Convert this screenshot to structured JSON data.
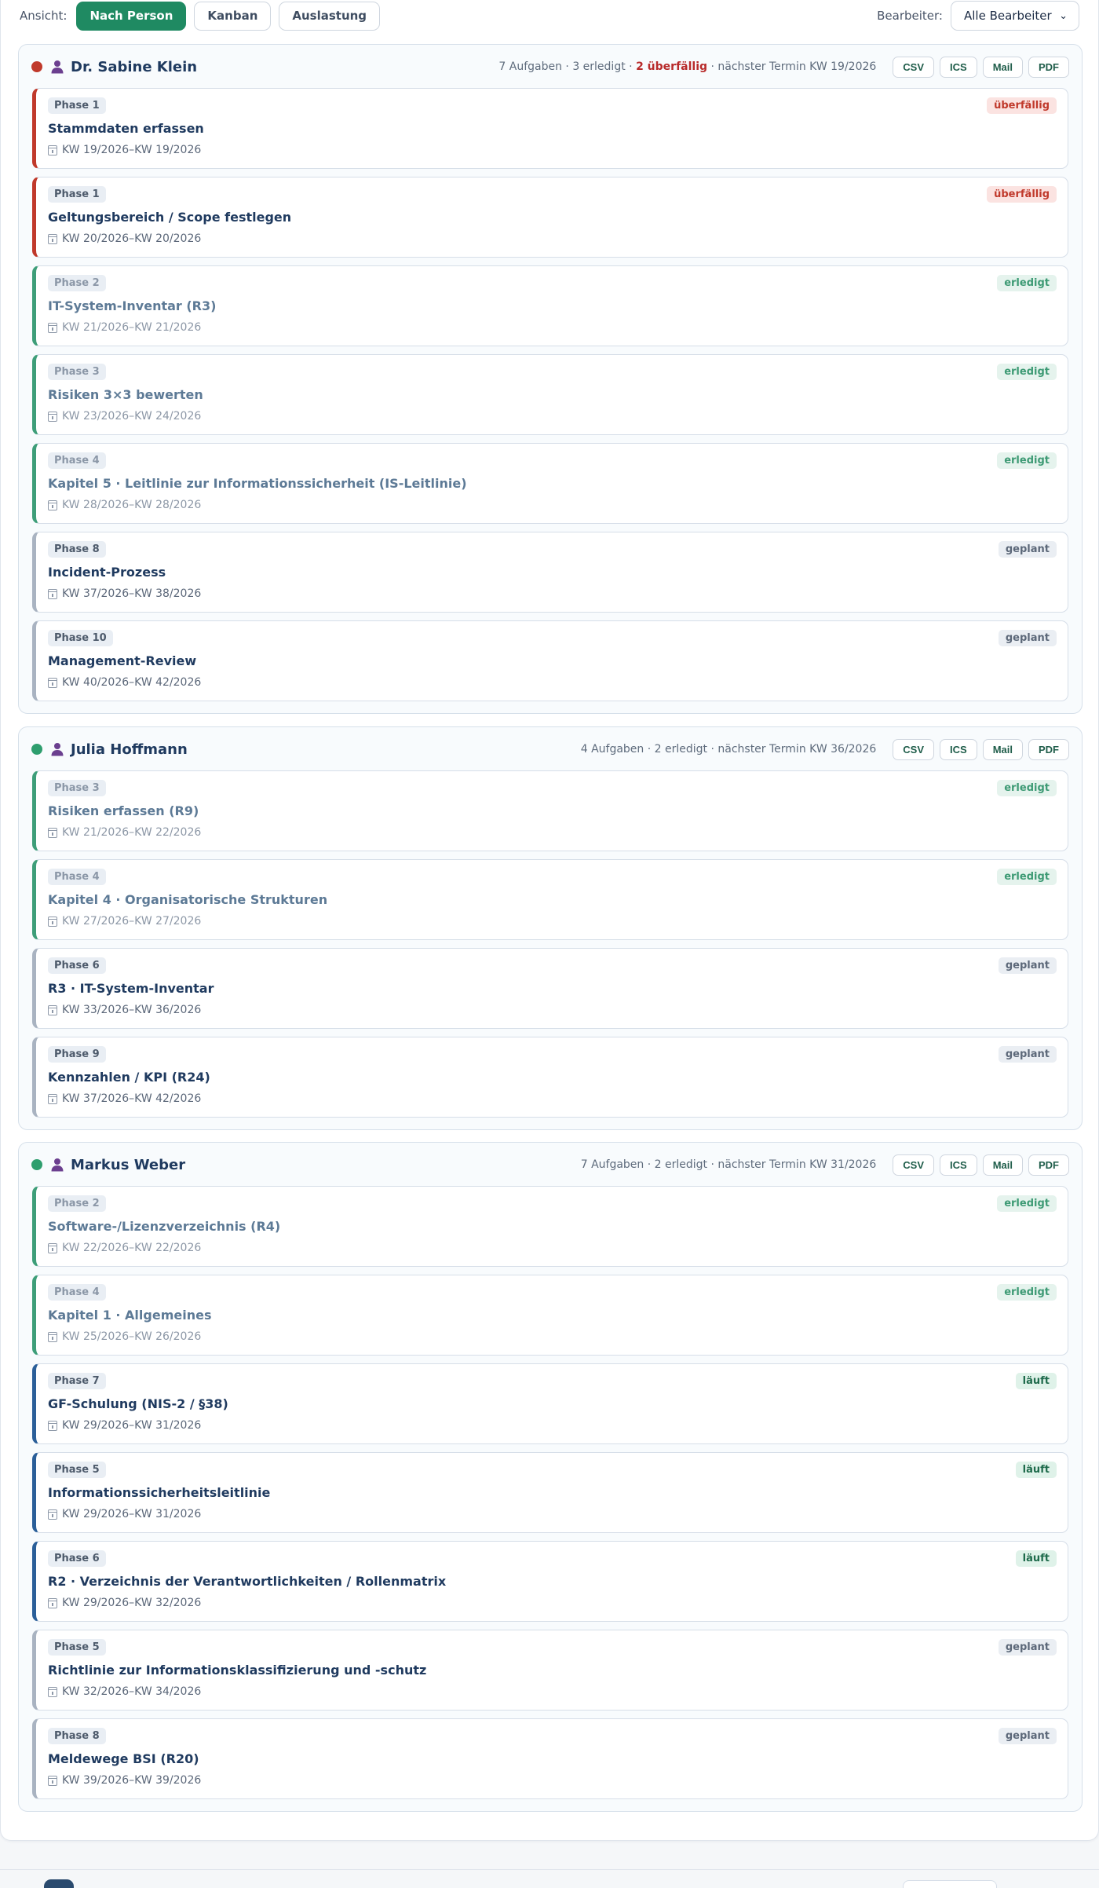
{
  "toolbar": {
    "ansicht_label": "Ansicht:",
    "views": [
      "Nach Person",
      "Kanban",
      "Auslastung"
    ],
    "active_view": "Nach Person",
    "bearbeiter_label": "Bearbeiter:",
    "bearbeiter_value": "Alle Bearbeiter"
  },
  "export_buttons": [
    "CSV",
    "ICS",
    "Mail",
    "PDF"
  ],
  "colors": {
    "accent": "#1f8a62",
    "overdue": "#c0392b",
    "done": "#3e9e79",
    "running": "#2b5f99",
    "planned": "#a9b3c1"
  },
  "groups": [
    {
      "name": "Dr. Sabine Klein",
      "dot_color": "#c0392b",
      "stats_prefix": "7 Aufgaben · 3 erledigt · ",
      "stats_overdue": "2 überfällig",
      "stats_suffix": " · nächster Termin KW 19/2026",
      "tasks": [
        {
          "phase": "Phase 1",
          "title": "Stammdaten erfassen",
          "date": "KW 19/2026–KW 19/2026",
          "status": "overdue",
          "badge": "überfällig"
        },
        {
          "phase": "Phase 1",
          "title": "Geltungsbereich / Scope festlegen",
          "date": "KW 20/2026–KW 20/2026",
          "status": "overdue",
          "badge": "überfällig"
        },
        {
          "phase": "Phase 2",
          "title": "IT-System-Inventar (R3)",
          "date": "KW 21/2026–KW 21/2026",
          "status": "done",
          "badge": "erledigt"
        },
        {
          "phase": "Phase 3",
          "title": "Risiken 3×3 bewerten",
          "date": "KW 23/2026–KW 24/2026",
          "status": "done",
          "badge": "erledigt"
        },
        {
          "phase": "Phase 4",
          "title": "Kapitel 5 · Leitlinie zur Informationssicherheit (IS-Leitlinie)",
          "date": "KW 28/2026–KW 28/2026",
          "status": "done",
          "badge": "erledigt"
        },
        {
          "phase": "Phase 8",
          "title": "Incident-Prozess",
          "date": "KW 37/2026–KW 38/2026",
          "status": "planned",
          "badge": "geplant"
        },
        {
          "phase": "Phase 10",
          "title": "Management-Review",
          "date": "KW 40/2026–KW 42/2026",
          "status": "planned",
          "badge": "geplant"
        }
      ]
    },
    {
      "name": "Julia Hoffmann",
      "dot_color": "#2e9e6e",
      "stats_prefix": "4 Aufgaben · 2 erledigt · nächster Termin KW 36/2026",
      "stats_overdue": "",
      "stats_suffix": "",
      "tasks": [
        {
          "phase": "Phase 3",
          "title": "Risiken erfassen (R9)",
          "date": "KW 21/2026–KW 22/2026",
          "status": "done",
          "badge": "erledigt"
        },
        {
          "phase": "Phase 4",
          "title": "Kapitel 4 · Organisatorische Strukturen",
          "date": "KW 27/2026–KW 27/2026",
          "status": "done",
          "badge": "erledigt"
        },
        {
          "phase": "Phase 6",
          "title": "R3 · IT-System-Inventar",
          "date": "KW 33/2026–KW 36/2026",
          "status": "planned",
          "badge": "geplant"
        },
        {
          "phase": "Phase 9",
          "title": "Kennzahlen / KPI (R24)",
          "date": "KW 37/2026–KW 42/2026",
          "status": "planned",
          "badge": "geplant"
        }
      ]
    },
    {
      "name": "Markus Weber",
      "dot_color": "#2e9e6e",
      "stats_prefix": "7 Aufgaben · 2 erledigt · nächster Termin KW 31/2026",
      "stats_overdue": "",
      "stats_suffix": "",
      "tasks": [
        {
          "phase": "Phase 2",
          "title": "Software-/Lizenzverzeichnis (R4)",
          "date": "KW 22/2026–KW 22/2026",
          "status": "done",
          "badge": "erledigt"
        },
        {
          "phase": "Phase 4",
          "title": "Kapitel 1 · Allgemeines",
          "date": "KW 25/2026–KW 26/2026",
          "status": "done",
          "badge": "erledigt"
        },
        {
          "phase": "Phase 7",
          "title": "GF-Schulung (NIS-2 / §38)",
          "date": "KW 29/2026–KW 31/2026",
          "status": "running",
          "badge": "läuft"
        },
        {
          "phase": "Phase 5",
          "title": "Informationssicherheitsleitlinie",
          "date": "KW 29/2026–KW 31/2026",
          "status": "running",
          "badge": "läuft"
        },
        {
          "phase": "Phase 6",
          "title": "R2 · Verzeichnis der Verantwortlichkeiten / Rollenmatrix",
          "date": "KW 29/2026–KW 32/2026",
          "status": "running",
          "badge": "läuft"
        },
        {
          "phase": "Phase 5",
          "title": "Richtlinie zur Informationsklassifizierung und -schutz",
          "date": "KW 32/2026–KW 34/2026",
          "status": "planned",
          "badge": "geplant"
        },
        {
          "phase": "Phase 8",
          "title": "Meldewege BSI (R20)",
          "date": "KW 39/2026–KW 39/2026",
          "status": "planned",
          "badge": "geplant"
        }
      ]
    }
  ]
}
